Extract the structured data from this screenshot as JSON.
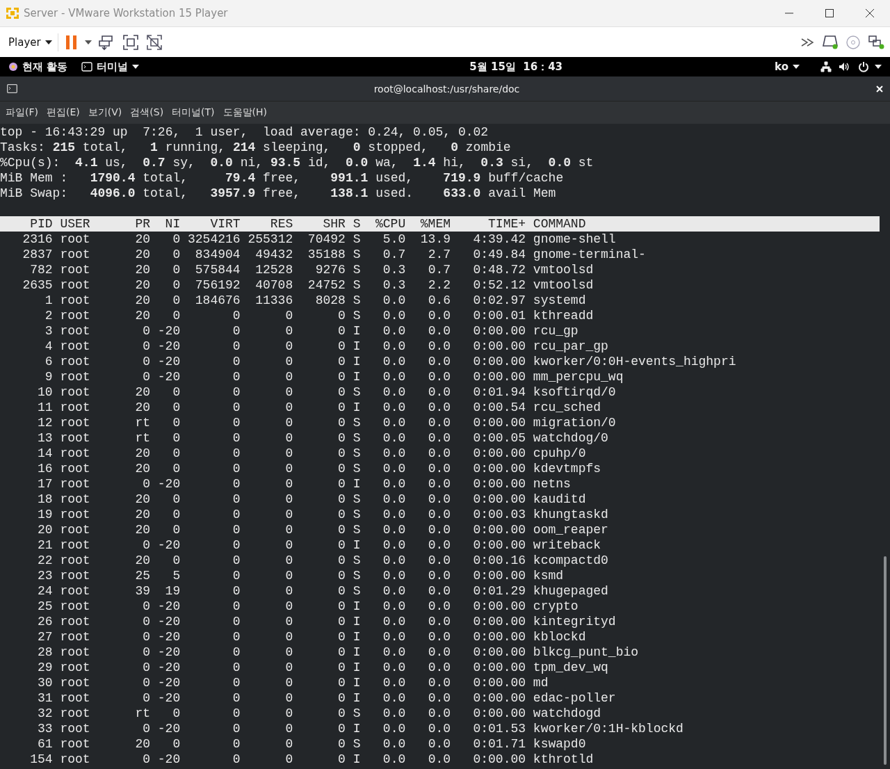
{
  "window": {
    "title": "Server - VMware Workstation 15 Player"
  },
  "toolbar": {
    "player_menu": "Player"
  },
  "gnome_bar": {
    "activities": "현재 활동",
    "app_menu": "터미널",
    "clock": "5월 15일  16：43",
    "input_method": "ko"
  },
  "terminal": {
    "title": "root@localhost:/usr/share/doc",
    "menu": [
      "파일(F)",
      "편집(E)",
      "보기(V)",
      "검색(S)",
      "터미널(T)",
      "도움말(H)"
    ],
    "summary": [
      "top - 16:43:29 up  7:26,  1 user,  load average: 0.24, 0.05, 0.02",
      "Tasks: **215** total,   **1** running, **214** sleeping,   **0** stopped,   **0** zombie",
      "%Cpu(s):  **4.1** us,  **0.7** sy,  **0.0** ni, **93.5** id,  **0.0** wa,  **1.4** hi,  **0.3** si,  **0.0** st",
      "MiB Mem :   **1790.4** total,     **79.4** free,    **991.1** used,    **719.9** buff/cache",
      "MiB Swap:   **4096.0** total,   **3957.9** free,    **138.1** used.    **633.0** avail Mem"
    ],
    "columns": [
      "PID",
      "USER",
      "PR",
      "NI",
      "VIRT",
      "RES",
      "SHR",
      "S",
      "%CPU",
      "%MEM",
      "TIME+",
      "COMMAND"
    ],
    "rows": [
      [
        "2316",
        "root",
        "20",
        "0",
        "3254216",
        "255312",
        "70492",
        "S",
        "5.0",
        "13.9",
        "4:39.42",
        "gnome-shell"
      ],
      [
        "2837",
        "root",
        "20",
        "0",
        "834904",
        "49432",
        "35188",
        "S",
        "0.7",
        "2.7",
        "0:49.84",
        "gnome-terminal-"
      ],
      [
        "782",
        "root",
        "20",
        "0",
        "575844",
        "12528",
        "9276",
        "S",
        "0.3",
        "0.7",
        "0:48.72",
        "vmtoolsd"
      ],
      [
        "2635",
        "root",
        "20",
        "0",
        "756192",
        "40708",
        "24752",
        "S",
        "0.3",
        "2.2",
        "0:52.12",
        "vmtoolsd"
      ],
      [
        "1",
        "root",
        "20",
        "0",
        "184676",
        "11336",
        "8028",
        "S",
        "0.0",
        "0.6",
        "0:02.97",
        "systemd"
      ],
      [
        "2",
        "root",
        "20",
        "0",
        "0",
        "0",
        "0",
        "S",
        "0.0",
        "0.0",
        "0:00.01",
        "kthreadd"
      ],
      [
        "3",
        "root",
        "0",
        "-20",
        "0",
        "0",
        "0",
        "I",
        "0.0",
        "0.0",
        "0:00.00",
        "rcu_gp"
      ],
      [
        "4",
        "root",
        "0",
        "-20",
        "0",
        "0",
        "0",
        "I",
        "0.0",
        "0.0",
        "0:00.00",
        "rcu_par_gp"
      ],
      [
        "6",
        "root",
        "0",
        "-20",
        "0",
        "0",
        "0",
        "I",
        "0.0",
        "0.0",
        "0:00.00",
        "kworker/0:0H-events_highpri"
      ],
      [
        "9",
        "root",
        "0",
        "-20",
        "0",
        "0",
        "0",
        "I",
        "0.0",
        "0.0",
        "0:00.00",
        "mm_percpu_wq"
      ],
      [
        "10",
        "root",
        "20",
        "0",
        "0",
        "0",
        "0",
        "S",
        "0.0",
        "0.0",
        "0:01.94",
        "ksoftirqd/0"
      ],
      [
        "11",
        "root",
        "20",
        "0",
        "0",
        "0",
        "0",
        "I",
        "0.0",
        "0.0",
        "0:00.54",
        "rcu_sched"
      ],
      [
        "12",
        "root",
        "rt",
        "0",
        "0",
        "0",
        "0",
        "S",
        "0.0",
        "0.0",
        "0:00.00",
        "migration/0"
      ],
      [
        "13",
        "root",
        "rt",
        "0",
        "0",
        "0",
        "0",
        "S",
        "0.0",
        "0.0",
        "0:00.05",
        "watchdog/0"
      ],
      [
        "14",
        "root",
        "20",
        "0",
        "0",
        "0",
        "0",
        "S",
        "0.0",
        "0.0",
        "0:00.00",
        "cpuhp/0"
      ],
      [
        "16",
        "root",
        "20",
        "0",
        "0",
        "0",
        "0",
        "S",
        "0.0",
        "0.0",
        "0:00.00",
        "kdevtmpfs"
      ],
      [
        "17",
        "root",
        "0",
        "-20",
        "0",
        "0",
        "0",
        "I",
        "0.0",
        "0.0",
        "0:00.00",
        "netns"
      ],
      [
        "18",
        "root",
        "20",
        "0",
        "0",
        "0",
        "0",
        "S",
        "0.0",
        "0.0",
        "0:00.00",
        "kauditd"
      ],
      [
        "19",
        "root",
        "20",
        "0",
        "0",
        "0",
        "0",
        "S",
        "0.0",
        "0.0",
        "0:00.03",
        "khungtaskd"
      ],
      [
        "20",
        "root",
        "20",
        "0",
        "0",
        "0",
        "0",
        "S",
        "0.0",
        "0.0",
        "0:00.00",
        "oom_reaper"
      ],
      [
        "21",
        "root",
        "0",
        "-20",
        "0",
        "0",
        "0",
        "I",
        "0.0",
        "0.0",
        "0:00.00",
        "writeback"
      ],
      [
        "22",
        "root",
        "20",
        "0",
        "0",
        "0",
        "0",
        "S",
        "0.0",
        "0.0",
        "0:00.16",
        "kcompactd0"
      ],
      [
        "23",
        "root",
        "25",
        "5",
        "0",
        "0",
        "0",
        "S",
        "0.0",
        "0.0",
        "0:00.00",
        "ksmd"
      ],
      [
        "24",
        "root",
        "39",
        "19",
        "0",
        "0",
        "0",
        "S",
        "0.0",
        "0.0",
        "0:01.29",
        "khugepaged"
      ],
      [
        "25",
        "root",
        "0",
        "-20",
        "0",
        "0",
        "0",
        "I",
        "0.0",
        "0.0",
        "0:00.00",
        "crypto"
      ],
      [
        "26",
        "root",
        "0",
        "-20",
        "0",
        "0",
        "0",
        "I",
        "0.0",
        "0.0",
        "0:00.00",
        "kintegrityd"
      ],
      [
        "27",
        "root",
        "0",
        "-20",
        "0",
        "0",
        "0",
        "I",
        "0.0",
        "0.0",
        "0:00.00",
        "kblockd"
      ],
      [
        "28",
        "root",
        "0",
        "-20",
        "0",
        "0",
        "0",
        "I",
        "0.0",
        "0.0",
        "0:00.00",
        "blkcg_punt_bio"
      ],
      [
        "29",
        "root",
        "0",
        "-20",
        "0",
        "0",
        "0",
        "I",
        "0.0",
        "0.0",
        "0:00.00",
        "tpm_dev_wq"
      ],
      [
        "30",
        "root",
        "0",
        "-20",
        "0",
        "0",
        "0",
        "I",
        "0.0",
        "0.0",
        "0:00.00",
        "md"
      ],
      [
        "31",
        "root",
        "0",
        "-20",
        "0",
        "0",
        "0",
        "I",
        "0.0",
        "0.0",
        "0:00.00",
        "edac-poller"
      ],
      [
        "32",
        "root",
        "rt",
        "0",
        "0",
        "0",
        "0",
        "S",
        "0.0",
        "0.0",
        "0:00.00",
        "watchdogd"
      ],
      [
        "33",
        "root",
        "0",
        "-20",
        "0",
        "0",
        "0",
        "I",
        "0.0",
        "0.0",
        "0:01.53",
        "kworker/0:1H-kblockd"
      ],
      [
        "61",
        "root",
        "20",
        "0",
        "0",
        "0",
        "0",
        "S",
        "0.0",
        "0.0",
        "0:01.71",
        "kswapd0"
      ],
      [
        "154",
        "root",
        "0",
        "-20",
        "0",
        "0",
        "0",
        "I",
        "0.0",
        "0.0",
        "0:00.00",
        "kthrotld"
      ]
    ]
  }
}
